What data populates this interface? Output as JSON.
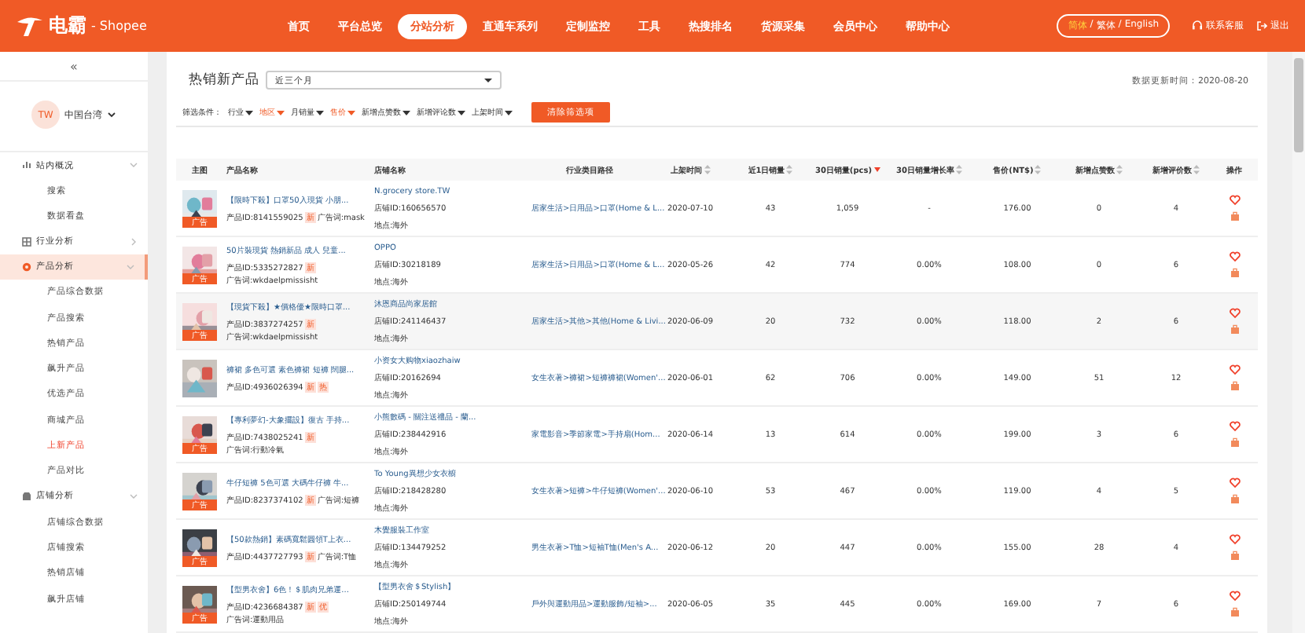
{
  "header": {
    "logo": "电霸",
    "platform": "- Shopee",
    "nav": [
      {
        "label": "首页",
        "selected": false
      },
      {
        "label": "平台总览",
        "selected": false
      },
      {
        "label": "分站分析",
        "selected": true
      },
      {
        "label": "直通车系列",
        "selected": false
      },
      {
        "label": "定制监控",
        "selected": false
      },
      {
        "label": "工具",
        "selected": false
      },
      {
        "label": "热搜排名",
        "selected": false
      },
      {
        "label": "货源采集",
        "selected": false
      },
      {
        "label": "会员中心",
        "selected": false
      },
      {
        "label": "帮助中心",
        "selected": false
      }
    ],
    "language_separator": "/",
    "languages": [
      {
        "label": "简体",
        "selected": true
      },
      {
        "label": "繁体",
        "selected": false
      },
      {
        "label": "English",
        "selected": false
      }
    ],
    "contact": "联系客服",
    "logout": "退出"
  },
  "sidebar": {
    "collapse": "«",
    "region": {
      "code": "TW",
      "name": "中国台湾"
    },
    "groups": [
      {
        "label": "站内概况",
        "kind": "chart",
        "expanded": true,
        "selected": false,
        "children": [
          {
            "label": "搜索",
            "selected": false
          },
          {
            "label": "数据看盘",
            "selected": false
          }
        ]
      },
      {
        "label": "行业分析",
        "kind": "grid",
        "expanded": false,
        "selected": false
      },
      {
        "label": "产品分析",
        "kind": "product",
        "expanded": true,
        "selected": true,
        "children": [
          {
            "label": "产品综合数据",
            "selected": false
          },
          {
            "label": "产品搜索",
            "selected": false
          },
          {
            "label": "热销产品",
            "selected": false
          },
          {
            "label": "飙升产品",
            "selected": false
          },
          {
            "label": "优选产品",
            "selected": false
          },
          {
            "label": "商城产品",
            "selected": false
          },
          {
            "label": "上新产品",
            "selected": true
          },
          {
            "label": "产品对比",
            "selected": false
          }
        ]
      },
      {
        "label": "店铺分析",
        "kind": "shop",
        "expanded": true,
        "selected": false,
        "children": [
          {
            "label": "店铺综合数据",
            "selected": false
          },
          {
            "label": "店铺搜索",
            "selected": false
          },
          {
            "label": "热销店铺",
            "selected": false
          },
          {
            "label": "飙升店铺",
            "selected": false
          }
        ]
      }
    ]
  },
  "main": {
    "title": "热销新产品",
    "period": "近三个月",
    "updated": "数据更新时间：2020-08-20",
    "filter_label": "筛选条件：",
    "filters": [
      {
        "label": "行业",
        "active": false
      },
      {
        "label": "地区",
        "active": true
      },
      {
        "label": "月销量",
        "active": false
      },
      {
        "label": "售价",
        "active": true
      },
      {
        "label": "新增点赞数",
        "active": false
      },
      {
        "label": "新增评论数",
        "active": false
      },
      {
        "label": "上架时间",
        "active": false
      }
    ],
    "clear_button": "清除筛选项",
    "table": {
      "columns": [
        {
          "label": "主图",
          "sortable": false
        },
        {
          "label": "产品名称",
          "sortable": false
        },
        {
          "label": "店铺名称",
          "sortable": false
        },
        {
          "label": "行业类目路径",
          "sortable": false
        },
        {
          "label": "上架时间",
          "sortable": true,
          "sorted": false
        },
        {
          "label": "近1日销量",
          "sortable": true,
          "sorted": false
        },
        {
          "label": "30日销量(pcs)",
          "sortable": true,
          "sorted": true
        },
        {
          "label": "30日销量增长率",
          "sortable": true,
          "sorted": false
        },
        {
          "label": "售价(NT$)",
          "sortable": true,
          "sorted": false
        },
        {
          "label": "新增点赞数",
          "sortable": true,
          "sorted": false
        },
        {
          "label": "新增评价数",
          "sortable": true,
          "sorted": false
        },
        {
          "label": "操作",
          "sortable": false
        }
      ],
      "rows": [
        {
          "thumb_label": "广告",
          "name": "【限時下殺】口罩50入現貨 小朋...",
          "product_id": "产品ID:8141559025",
          "tags": [
            "新"
          ],
          "keyword": "广告词:mask",
          "shop": "N.grocery store.TW",
          "shop_id": "店铺ID:160656570",
          "location": "地点:海外",
          "category": "居家生活>日用品>口罩(Home & L...",
          "listed": "2020-07-10",
          "sales_1d": "43",
          "sales_30d": "1,059",
          "growth": "-",
          "price": "176.00",
          "likes": "0",
          "reviews": "4"
        },
        {
          "thumb_label": "广告",
          "name": "50片裝現貨 熱銷新品 成人 兒童...",
          "product_id": "产品ID:5335272827",
          "tags": [
            "新"
          ],
          "keyword": "广告词:wkdaelpmissisht",
          "shop": "OPPO",
          "shop_id": "店铺ID:30218189",
          "location": "地点:海外",
          "category": "居家生活>日用品>口罩(Home & L...",
          "listed": "2020-05-26",
          "sales_1d": "42",
          "sales_30d": "774",
          "growth": "0.00%",
          "price": "108.00",
          "likes": "0",
          "reviews": "6"
        },
        {
          "thumb_label": "广告",
          "name": "【現貨下殺】★價格優★限時口罩...",
          "product_id": "产品ID:3837274257",
          "tags": [
            "新"
          ],
          "keyword": "广告词:wkdaelpmissisht",
          "shop": "沐恩商品尚家居館",
          "shop_id": "店铺ID:241146437",
          "location": "地点:海外",
          "category": "居家生活>其他>其他(Home & Livi...",
          "listed": "2020-06-09",
          "sales_1d": "20",
          "sales_30d": "732",
          "growth": "0.00%",
          "price": "118.00",
          "likes": "2",
          "reviews": "6"
        },
        {
          "name": "褲裙 多色可選 素色褲裙 短褲 闊腿...",
          "product_id": "产品ID:4936026394",
          "tags": [
            "新",
            "热"
          ],
          "shop": "小资女大购物xiaozhaiw",
          "shop_id": "店铺ID:20162694",
          "location": "地点:海外",
          "category": "女生衣著>褲裙>短褲褲裙(Women'...",
          "listed": "2020-06-01",
          "sales_1d": "62",
          "sales_30d": "706",
          "growth": "0.00%",
          "price": "149.00",
          "likes": "51",
          "reviews": "12"
        },
        {
          "thumb_label": "广告",
          "name": "【專利夢幻-大象擺設】復古 手持...",
          "product_id": "产品ID:7438025241",
          "tags": [
            "新"
          ],
          "keyword": "广告词:行動冷氣",
          "shop": "小熊數碼 - 關注送禮品 - 蘭...",
          "shop_id": "店铺ID:238442916",
          "location": "地点:海外",
          "category": "家電影音>季節家電>手持扇(Hom...",
          "listed": "2020-06-14",
          "sales_1d": "13",
          "sales_30d": "614",
          "growth": "0.00%",
          "price": "199.00",
          "likes": "3",
          "reviews": "6"
        },
        {
          "thumb_label": "广告",
          "name": "牛仔短褲 5色可選 大碼牛仔褲 牛...",
          "product_id": "产品ID:8237374102",
          "tags": [
            "新"
          ],
          "keyword": "广告词:短褲",
          "shop": "To Young異想少女衣櫥",
          "shop_id": "店铺ID:218428280",
          "location": "地点:海外",
          "category": "女生衣著>短褲>牛仔短褲(Women'...",
          "listed": "2020-06-10",
          "sales_1d": "53",
          "sales_30d": "467",
          "growth": "0.00%",
          "price": "119.00",
          "likes": "4",
          "reviews": "5"
        },
        {
          "thumb_label": "广告",
          "name": "【50款熱銷】素碼寬鬆圓領T上衣...",
          "product_id": "产品ID:4437727793",
          "tags": [
            "新"
          ],
          "keyword": "广告词:T恤",
          "shop": "木覺服裝工作室",
          "shop_id": "店铺ID:134479252",
          "location": "地点:海外",
          "category": "男生衣著>T恤>短袖T恤(Men's A...",
          "listed": "2020-06-12",
          "sales_1d": "20",
          "sales_30d": "447",
          "growth": "0.00%",
          "price": "155.00",
          "likes": "28",
          "reviews": "4"
        },
        {
          "thumb_label": "广告",
          "name": "【型男衣舍】6色！＄肌肉兄弟運...",
          "product_id": "产品ID:4236684387",
          "tags": [
            "新",
            "优"
          ],
          "keyword": "广告词:運動用品",
          "shop": "【型男衣舍＄Stylish】",
          "shop_id": "店铺ID:250149744",
          "location": "地点:海外",
          "category": "戶外與運動用品>運動服飾/短袖>...",
          "listed": "2020-06-05",
          "sales_1d": "35",
          "sales_30d": "445",
          "growth": "0.00%",
          "price": "169.00",
          "likes": "7",
          "reviews": "6"
        }
      ]
    }
  }
}
